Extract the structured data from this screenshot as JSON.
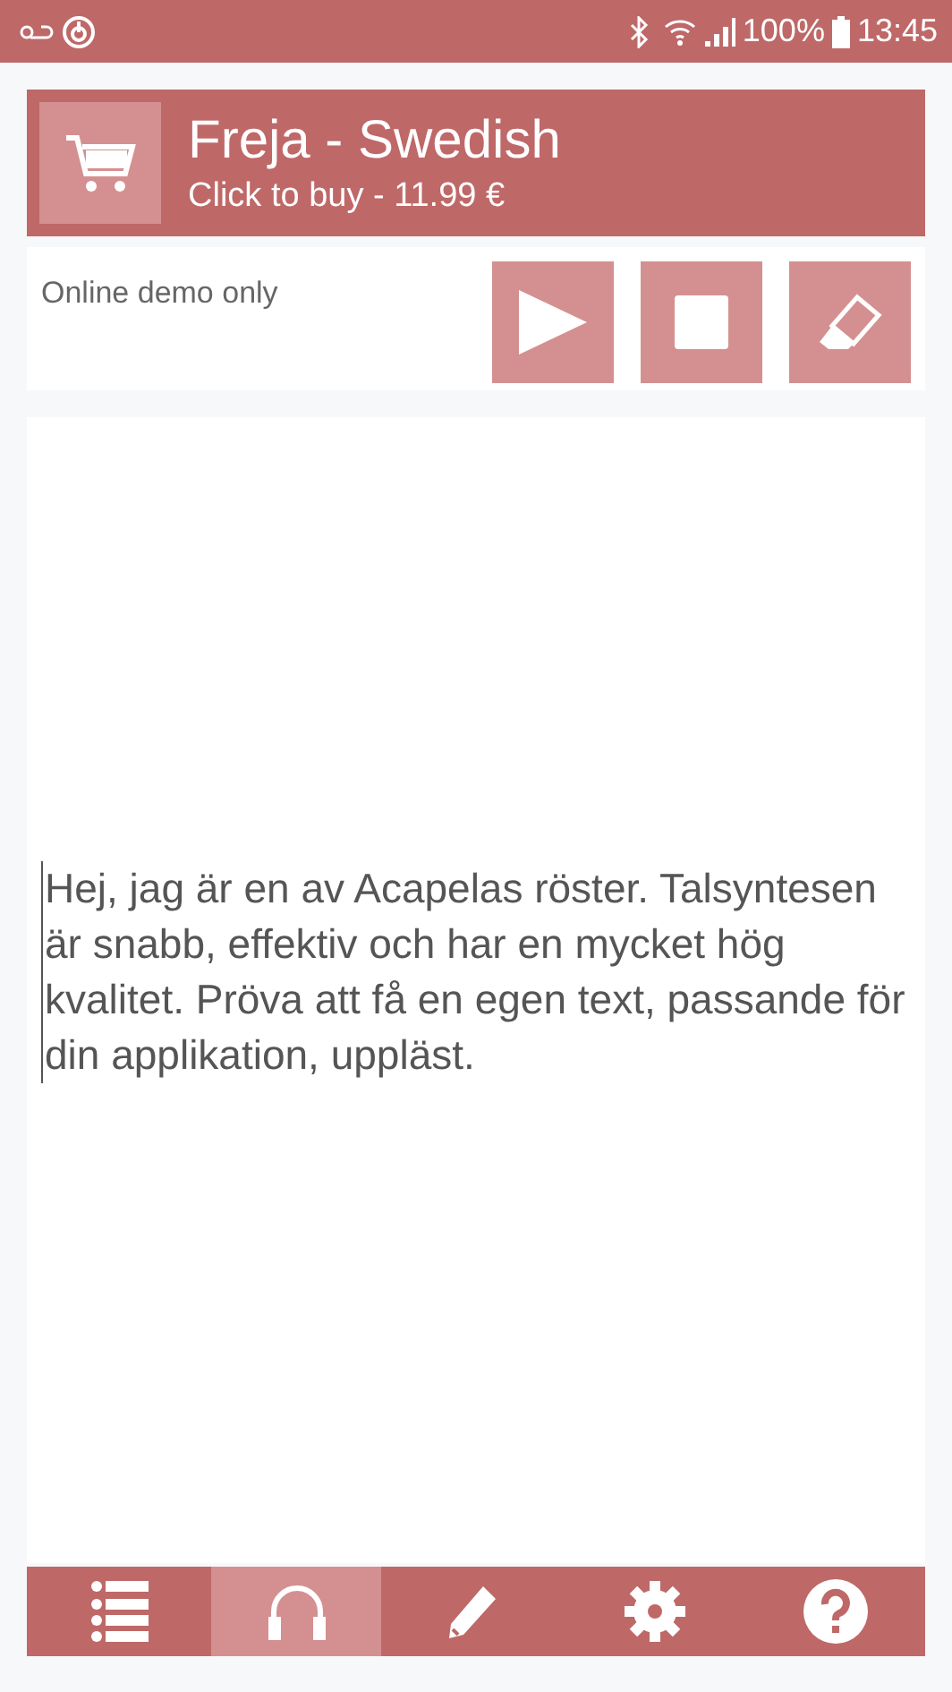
{
  "status_bar": {
    "battery": "100%",
    "time": "13:45"
  },
  "voice": {
    "title": "Freja - Swedish",
    "subtitle": "Click to buy - 11.99 €"
  },
  "demo_note": "Online demo only",
  "editor": {
    "value": "Hej, jag är en av Acapelas röster. Talsyntesen är snabb, effektiv och har en mycket hög kvalitet. Pröva att få en egen text, passande för din applikation, uppläst."
  },
  "nav": [
    {
      "kind": "list",
      "selected": false
    },
    {
      "kind": "headphones",
      "selected": true
    },
    {
      "kind": "pencil",
      "selected": false
    },
    {
      "kind": "gear",
      "selected": false
    },
    {
      "kind": "help",
      "selected": false
    }
  ]
}
